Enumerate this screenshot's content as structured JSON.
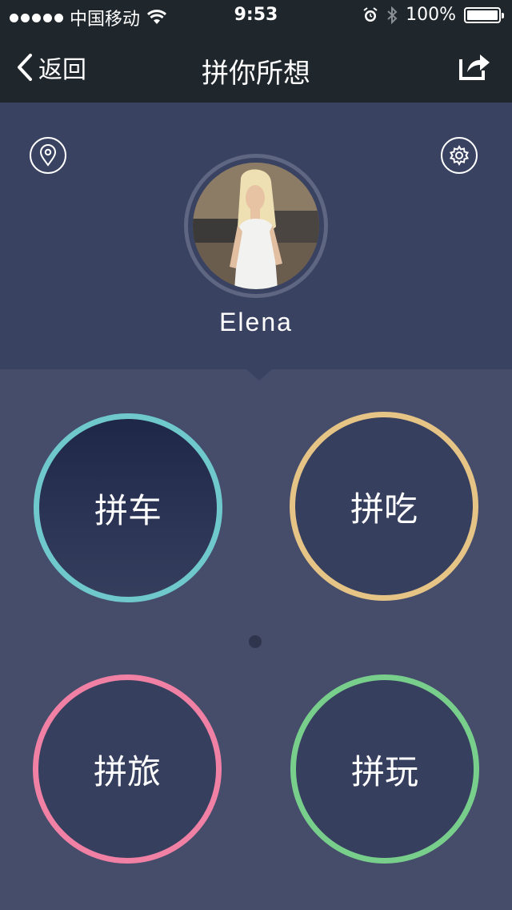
{
  "status_bar": {
    "carrier": "中国移动",
    "time": "9:53",
    "battery": "100%",
    "battery_level": 1.0,
    "icons": [
      "signal-dots-icon",
      "wifi-icon",
      "alarm-icon",
      "bluetooth-icon",
      "battery-icon"
    ]
  },
  "nav": {
    "back_label": "返回",
    "title": "拼你所想",
    "back_icon": "chevron-left-icon",
    "share_icon": "share-icon"
  },
  "profile": {
    "name": "Elena",
    "location_icon": "location-pin-icon",
    "settings_icon": "gear-icon"
  },
  "categories": [
    {
      "label": "拼车",
      "color": "#6fc9cc"
    },
    {
      "label": "拼吃",
      "color": "#e6c486"
    },
    {
      "label": "拼旅",
      "color": "#f080a4"
    },
    {
      "label": "拼玩",
      "color": "#78cf8c"
    }
  ],
  "colors": {
    "bar_bg": "#1f262c",
    "profile_bg": "#3a4262",
    "main_bg": "#454d6b"
  },
  "pager": {
    "current_page": 1
  }
}
